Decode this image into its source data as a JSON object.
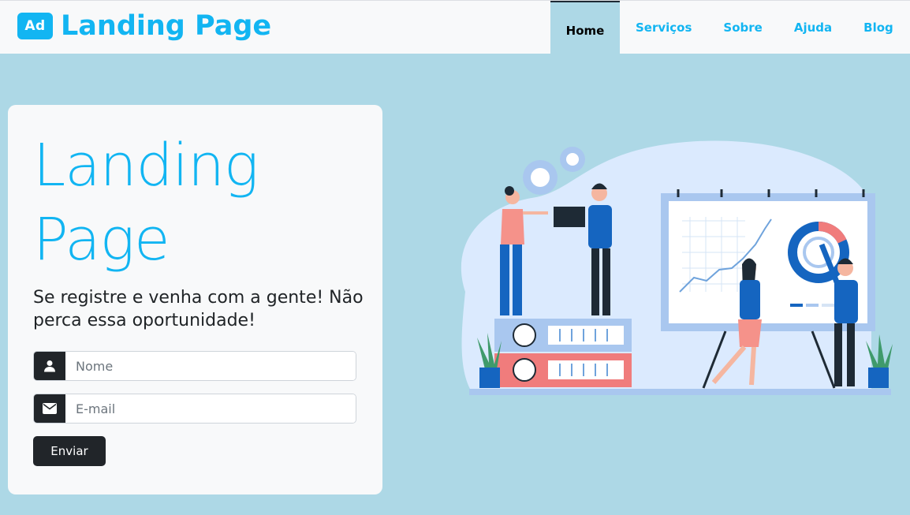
{
  "navbar": {
    "logo_text": "Ad",
    "brand": "Landing Page",
    "items": [
      {
        "label": "Home",
        "active": true
      },
      {
        "label": "Serviços"
      },
      {
        "label": "Sobre"
      },
      {
        "label": "Ajuda"
      },
      {
        "label": "Blog"
      }
    ]
  },
  "hero": {
    "title_line1": "Landing",
    "title_line2": "Page",
    "subtitle": "Se registre e venha com a gente! Não perca essa oportunidade!"
  },
  "form": {
    "name_placeholder": "Nome",
    "email_placeholder": "E-mail",
    "submit_label": "Enviar"
  },
  "illustration": {
    "icon": "business-team-analytics-illustration"
  },
  "colors": {
    "accent": "#12b5f2",
    "background": "#add8e6",
    "dark": "#212529",
    "card": "#f8f9fa"
  }
}
